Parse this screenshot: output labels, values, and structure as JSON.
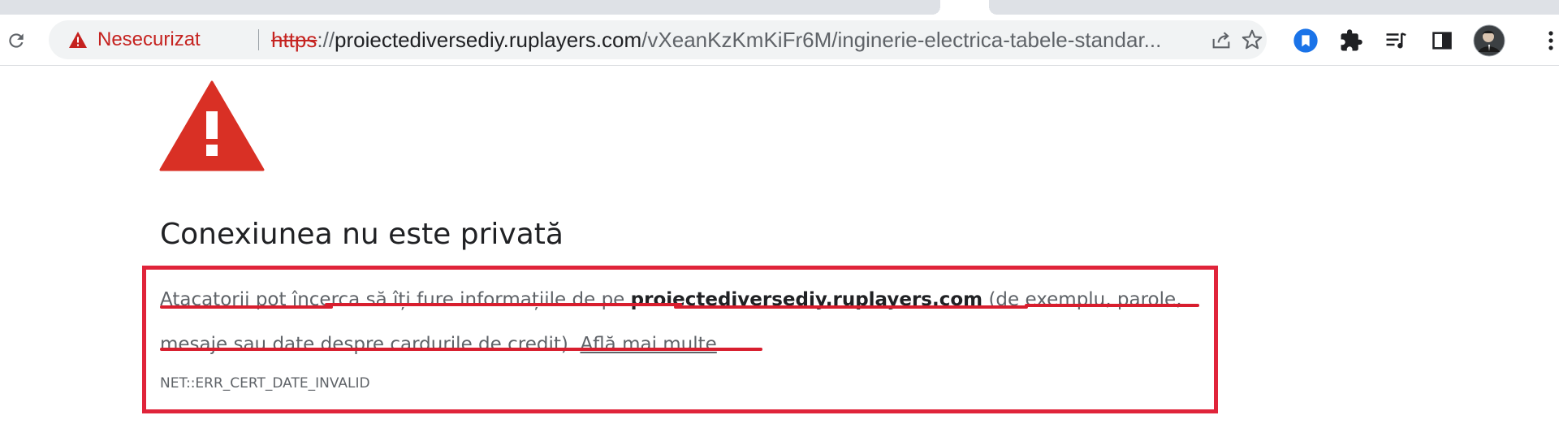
{
  "browser": {
    "security_chip": {
      "icon": "warning-triangle-icon",
      "label": "Nesecurizat",
      "color": "#c5221f"
    },
    "url": {
      "scheme": "https",
      "separator": "://",
      "host": "proiectediversediy.ruplayers.com",
      "path": "/vXeanKzKmKiFr6M/inginerie-electrica-tabele-standar..."
    },
    "omnibox_icons": [
      "share-icon",
      "bookmark-star-icon"
    ],
    "toolbar_icons": [
      "extension-shield-icon",
      "extensions-puzzle-icon",
      "reading-list-icon",
      "side-panel-icon",
      "profile-avatar",
      "menu-kebab-icon"
    ],
    "reload_icon": "reload-icon"
  },
  "interstitial": {
    "icon": "danger-triangle-icon",
    "icon_color": "#d93025",
    "heading": "Conexiunea nu este privată",
    "body_prefix": "Atacatorii pot încerca să îți fure informațiile de pe ",
    "body_host": "proiectediversediy.ruplayers.com",
    "body_suffix": " (de exemplu, parole, mesaje sau date despre cardurile de credit). ",
    "learn_more": "Află mai multe",
    "error_code": "NET::ERR_CERT_DATE_INVALID"
  },
  "annotation": {
    "color": "#e0243a"
  }
}
